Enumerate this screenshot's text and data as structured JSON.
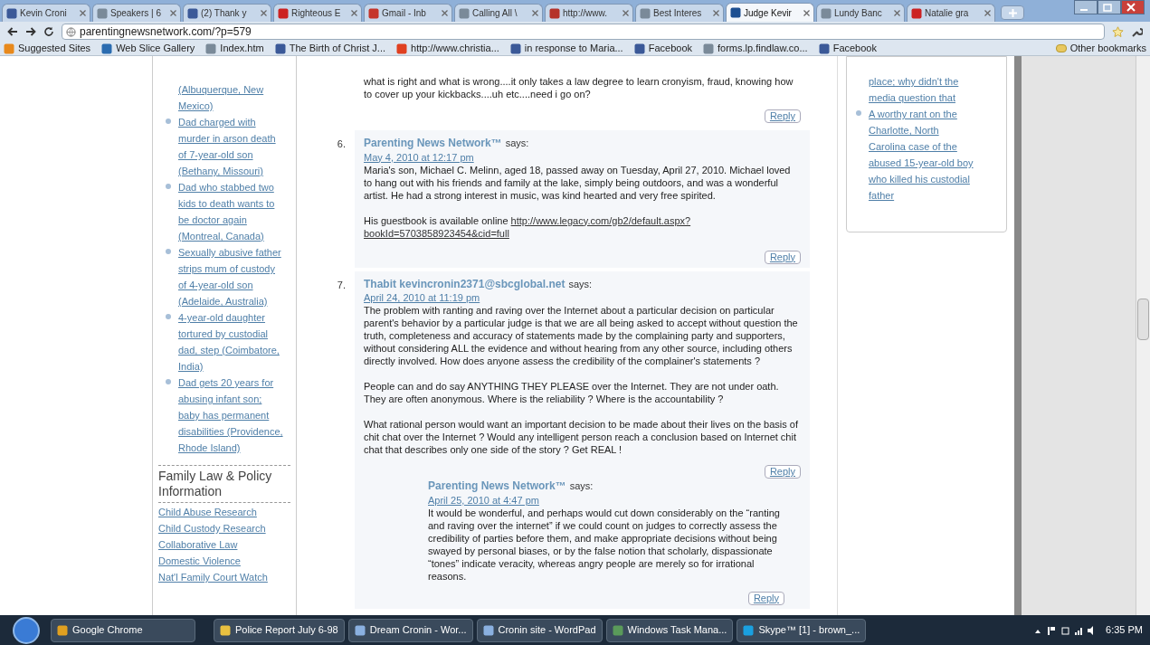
{
  "browser": {
    "tabs": [
      {
        "label": "Kevin Croni",
        "color": "#3b5998",
        "selected": false
      },
      {
        "label": "Speakers | 6",
        "color": "#7a8a99",
        "selected": false
      },
      {
        "label": "(2) Thank y",
        "color": "#3b5998",
        "selected": false
      },
      {
        "label": "Righteous E",
        "color": "#cc2222",
        "selected": false
      },
      {
        "label": "Gmail - Inb",
        "color": "#c5352a",
        "selected": false
      },
      {
        "label": "Calling All \\",
        "color": "#7a8a99",
        "selected": false
      },
      {
        "label": "http://www.",
        "color": "#b5322a",
        "selected": false
      },
      {
        "label": "Best Interes",
        "color": "#7a8a99",
        "selected": false
      },
      {
        "label": "Judge Kevir",
        "color": "#1d4f91",
        "selected": true
      },
      {
        "label": "Lundy Banc",
        "color": "#7a8a99",
        "selected": false
      },
      {
        "label": "Natalie gra",
        "color": "#cc2222",
        "selected": false
      }
    ],
    "address": "parentingnewsnetwork.com/?p=579",
    "bookmarks": [
      {
        "label": "Suggested Sites",
        "color": "#e8891c"
      },
      {
        "label": "Web Slice Gallery",
        "color": "#2b6cb0"
      },
      {
        "label": "Index.htm",
        "color": "#7a8a99"
      },
      {
        "label": "The Birth of Christ J...",
        "color": "#3b5998"
      },
      {
        "label": "http://www.christia...",
        "color": "#e04020"
      },
      {
        "label": "in response to Maria...",
        "color": "#3b5998"
      },
      {
        "label": "Facebook",
        "color": "#3b5998"
      },
      {
        "label": "forms.lp.findlaw.co...",
        "color": "#7a8a99"
      },
      {
        "label": "Facebook",
        "color": "#3b5998"
      }
    ],
    "other_bookmarks": "Other bookmarks"
  },
  "left_sidebar": {
    "links": [
      {
        "kind": "continued",
        "text": "(Albuquerque, New Mexico)"
      },
      {
        "kind": "item",
        "text": "Dad charged with murder in arson death of 7-year-old son (Bethany, Missouri)"
      },
      {
        "kind": "item",
        "text": "Dad who stabbed two kids to death wants to be doctor again (Montreal, Canada)"
      },
      {
        "kind": "item",
        "text": "Sexually abusive father strips mum of custody of 4-year-old son (Adelaide, Australia)"
      },
      {
        "kind": "item",
        "text": "4-year-old daughter tortured by custodial dad, step (Coimbatore, India)"
      },
      {
        "kind": "item",
        "text": "Dad gets 20 years for abusing infant son; baby has permanent disabilities (Providence, Rhode Island)"
      }
    ],
    "section_title": "Family Law & Policy Information",
    "section_links": [
      "Child Abuse Research",
      "Child Custody Research",
      "Collaborative Law",
      "Domestic Violence",
      "Nat'l Family Court Watch"
    ]
  },
  "comments": [
    {
      "paragraphs": [
        "what is right and what is wrong....it only takes a law degree to learn cronyism, fraud, knowing how to cover up your kickbacks....uh etc....need i go on?"
      ],
      "reply": "Reply"
    },
    {
      "number": "6.",
      "author": "Parenting News Network™",
      "says": "says:",
      "date": "May 4, 2010 at 12:17 pm",
      "paragraphs": [
        "Maria's son, Michael C. Melinn, aged 18, passed away on Tuesday, April 27, 2010. Michael loved to hang out with his friends and family at the lake, simply being outdoors, and was a wonderful artist. He had a strong interest in music, was kind hearted and very free spirited."
      ],
      "link_text": "His guestbook is available online",
      "link_lines": [
        "http://www.legacy.com/gb2/default.aspx?",
        "bookId=5703858923454&cid=full"
      ],
      "reply": "Reply"
    },
    {
      "number": "7.",
      "author": "Thabit kevincronin2371@sbcglobal.net",
      "says": "says:",
      "date": "April 24, 2010 at 11:19 pm",
      "paragraphs": [
        "The problem with ranting and raving over the Internet about a particular decision on particular parent's behavior by a particular judge is that we are all being asked to accept without question the truth, completeness and accuracy of statements made by the complaining party and supporters, without considering ALL the evidence and without hearing from any other source, including others directly involved. How does anyone assess the credibility of the complainer's statements ?",
        "People can and do say ANYTHING THEY PLEASE over the Internet. They are not under oath. They are often anonymous. Where is the reliability ? Where is the accountability ?",
        "What rational person would want an important decision to be made about their lives on the basis of chit chat over the Internet ? Would any intelligent person reach a conclusion based on Internet chit chat that describes only one side of the story ? Get REAL !"
      ],
      "reply": "Reply",
      "children": [
        {
          "author": "Parenting News Network™",
          "says": "says:",
          "date": "April 25, 2010 at 4:47 pm",
          "paragraphs": [
            "It would be wonderful, and perhaps would cut down considerably on the “ranting and raving over the internet” if we could count on judges to correctly assess the credibility of parties before them, and make appropriate decisions without being swayed by personal biases, or by the false notion that scholarly, dispassionate “tones” indicate veracity, whereas angry people are merely so for irrational reasons."
          ],
          "reply": "Reply"
        }
      ]
    }
  ],
  "right_sidebar": {
    "links": [
      {
        "kind": "continued",
        "text": "place; why didn't the media question that"
      },
      {
        "kind": "item",
        "text": "A worthy rant on the Charlotte, North Carolina case of the abused 15-year-old boy who killed his custodial father"
      }
    ]
  },
  "taskbar": {
    "items": [
      {
        "label": "Google Chrome",
        "color": "#e0a020"
      },
      {
        "label": "Police Report July 6-98",
        "color": "#e8c040"
      },
      {
        "label": "Dream Cronin - Wor...",
        "color": "#8ab0e0"
      },
      {
        "label": "Cronin site - WordPad",
        "color": "#8ab0e0"
      },
      {
        "label": "Windows Task Mana...",
        "color": "#5a9a5a"
      },
      {
        "label": "Skype™ [1] - brown_...",
        "color": "#1aa0e0"
      }
    ],
    "clock": "6:35 PM"
  }
}
